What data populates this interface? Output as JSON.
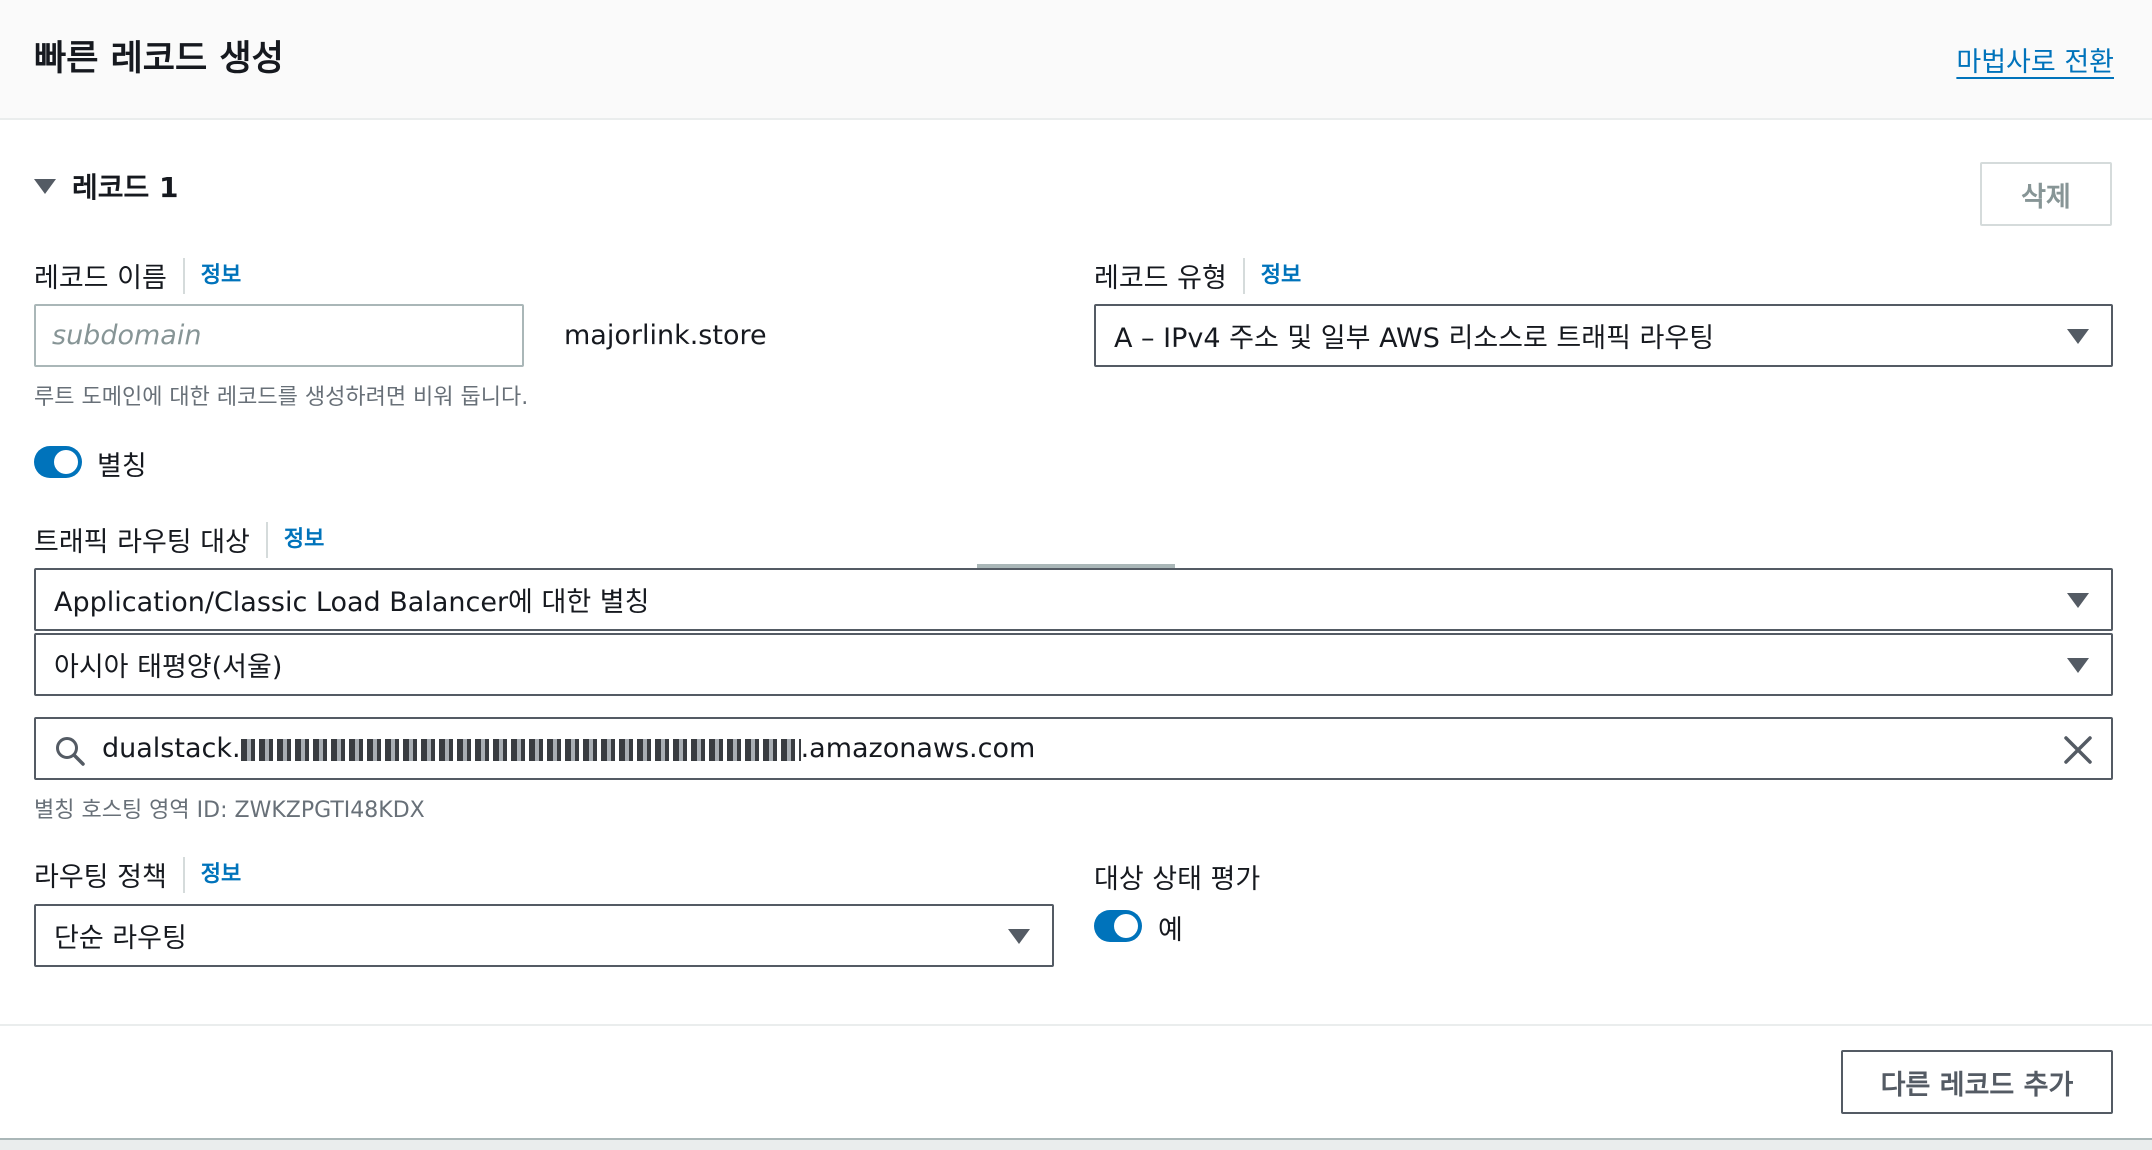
{
  "header": {
    "title": "빠른 레코드 생성",
    "wizard_link": "마법사로 전환"
  },
  "record": {
    "title": "레코드 1",
    "delete_label": "삭제"
  },
  "record_name": {
    "label": "레코드 이름",
    "info": "정보",
    "placeholder": "subdomain",
    "value": "",
    "domain_suffix": "majorlink.store",
    "help": "루트 도메인에 대한 레코드를 생성하려면 비워 둡니다."
  },
  "record_type": {
    "label": "레코드 유형",
    "info": "정보",
    "selected": "A – IPv4 주소 및 일부 AWS 리소스로 트래픽 라우팅"
  },
  "alias": {
    "label": "별칭",
    "enabled": true
  },
  "traffic_target": {
    "label": "트래픽 라우팅 대상",
    "info": "정보",
    "endpoint_type": "Application/Classic Load Balancer에 대한 별칭",
    "region": "아시아 태평양(서울)",
    "endpoint_prefix": "dualstack.",
    "endpoint_suffix": ".amazonaws.com",
    "hosted_zone_help": "별칭 호스팅 영역 ID: ZWKZPGTI48KDX"
  },
  "routing_policy": {
    "label": "라우팅 정책",
    "info": "정보",
    "selected": "단순 라우팅"
  },
  "health_eval": {
    "label": "대상 상태 평가",
    "value_label": "예",
    "enabled": true
  },
  "footer": {
    "add_record_label": "다른 레코드 추가"
  },
  "colors": {
    "accent": "#0073bb",
    "text": "#16191f",
    "muted": "#687078",
    "border": "#545b64"
  }
}
